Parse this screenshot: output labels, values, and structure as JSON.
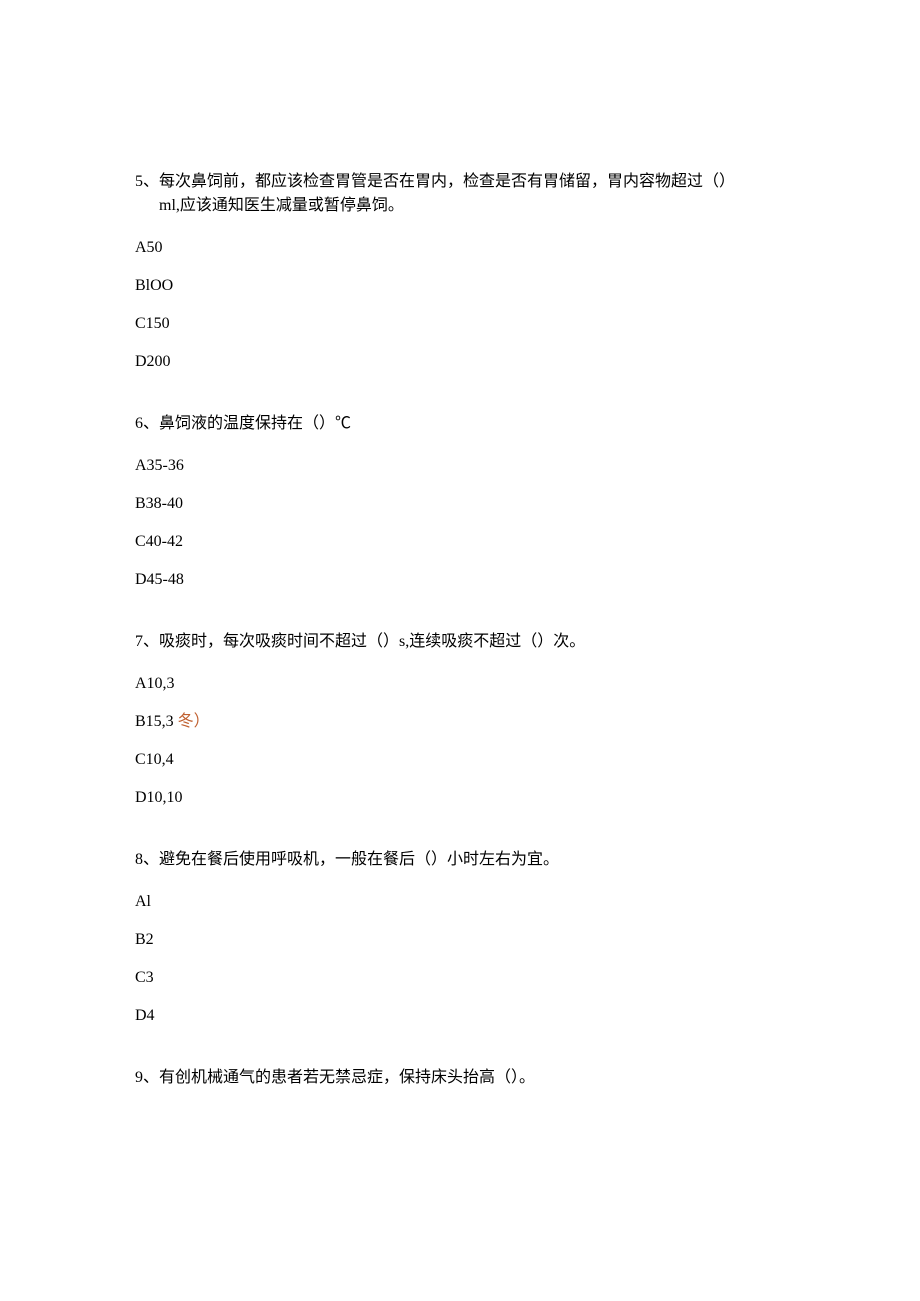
{
  "questions": [
    {
      "number": "5、",
      "text_line1": "每次鼻饲前，都应该检查胃管是否在胃内，检查是否有胃储留，胃内容物超过（）",
      "text_line2": "ml,应该通知医生减量或暂停鼻饲。",
      "options": [
        {
          "label": "A50"
        },
        {
          "label": "BlOO"
        },
        {
          "label": "C150"
        },
        {
          "label": "D200"
        }
      ]
    },
    {
      "number": "6、",
      "text_line1": "鼻饲液的温度保持在（）℃",
      "options": [
        {
          "label": "A35-36"
        },
        {
          "label": "B38-40"
        },
        {
          "label": "C40-42"
        },
        {
          "label": "D45-48"
        }
      ]
    },
    {
      "number": "7、",
      "text_line1": "吸痰时，每次吸痰时间不超过（）s,连续吸痰不超过（）次。",
      "options": [
        {
          "label": "A10,3"
        },
        {
          "label_prefix": "B15,3",
          "label_suffix": " 冬）",
          "highlighted": true
        },
        {
          "label": "C10,4"
        },
        {
          "label": "D10,10"
        }
      ]
    },
    {
      "number": "8、",
      "text_line1": "避免在餐后使用呼吸机，一般在餐后（）小时左右为宜。",
      "options": [
        {
          "label": "Al"
        },
        {
          "label": "B2"
        },
        {
          "label": "C3"
        },
        {
          "label": "D4"
        }
      ]
    },
    {
      "number": "9、",
      "text_line1": "有创机械通气的患者若无禁忌症，保持床头抬高（）。",
      "options": []
    }
  ]
}
